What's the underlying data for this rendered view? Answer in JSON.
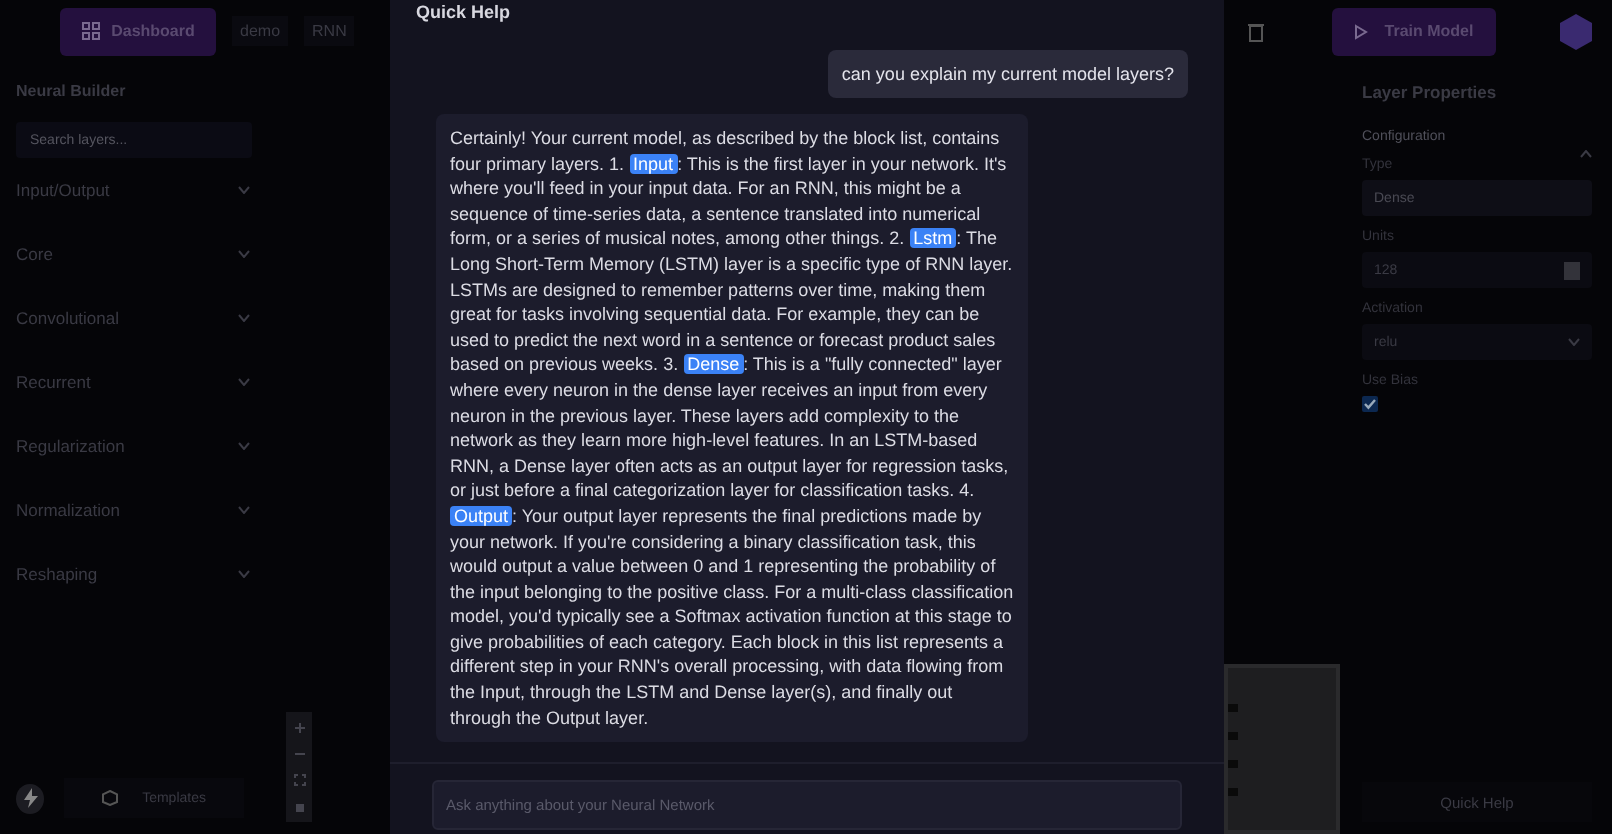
{
  "topbar": {
    "dashboard_button": "Dashboard",
    "breadcrumbs": [
      "demo",
      "RNN"
    ],
    "train_button": "Train Model"
  },
  "sidebar": {
    "title": "Neural Builder",
    "search": {
      "placeholder": "Search layers..."
    },
    "categories": [
      {
        "label": "Input/Output",
        "expanded": false
      },
      {
        "label": "Core",
        "expanded": false
      },
      {
        "label": "Convolutional",
        "expanded": false
      },
      {
        "label": "Recurrent",
        "expanded": false
      },
      {
        "label": "Regularization",
        "expanded": false
      },
      {
        "label": "Normalization",
        "expanded": false
      },
      {
        "label": "Reshaping",
        "expanded": false
      }
    ],
    "templates_button": "Templates"
  },
  "properties": {
    "title": "Layer Properties",
    "section": {
      "label": "Configuration",
      "expanded": true
    },
    "fields": [
      {
        "kind": "text",
        "label": "Type",
        "value": "Dense",
        "disabled": true
      },
      {
        "kind": "number",
        "label": "Units",
        "value": "128"
      },
      {
        "kind": "select",
        "label": "Activation",
        "value": "relu"
      },
      {
        "kind": "checkbox",
        "label": "Use Bias",
        "checked": true
      }
    ],
    "quick_help_button": "Quick Help"
  },
  "chat": {
    "title": "Quick Help",
    "messages": [
      {
        "kind": "user",
        "text": "can you explain my current model layers?"
      },
      {
        "kind": "assistant",
        "parts": [
          {
            "kind": "text",
            "text": "Certainly! Your current model, as described by the block list, contains four primary layers. 1. "
          },
          {
            "kind": "chip",
            "text": "Input"
          },
          {
            "kind": "text",
            "text": ": This is the first layer in your network. It's where you'll feed in your input data. For an RNN, this might be a sequence of time-series data, a sentence translated into numerical form, or a series of musical notes, among other things. 2. "
          },
          {
            "kind": "chip",
            "text": "Lstm"
          },
          {
            "kind": "text",
            "text": ": The Long Short-Term Memory (LSTM) layer is a specific type of RNN layer. LSTMs are designed to remember patterns over time, making them great for tasks involving sequential data. For example, they can be used to predict the next word in a sentence or forecast product sales based on previous weeks. 3. "
          },
          {
            "kind": "chip",
            "text": "Dense"
          },
          {
            "kind": "text",
            "text": ": This is a \"fully connected\" layer where every neuron in the dense layer receives an input from every neuron in the previous layer. These layers add complexity to the network as they learn more high-level features. In an LSTM-based RNN, a Dense layer often acts as an output layer for regression tasks, or just before a final categorization layer for classification tasks. 4. "
          },
          {
            "kind": "chip",
            "text": "Output"
          },
          {
            "kind": "text",
            "text": ": Your output layer represents the final predictions made by your network. If you're considering a binary classification task, this would output a value between 0 and 1 representing the probability of the input belonging to the positive class. For a multi-class classification model, you'd typically see a Softmax activation function at this stage to give probabilities of each category. Each block in this list represents a different step in your RNN's overall processing, with data flowing from the Input, through the LSTM and Dense layer(s), and finally out through the Output layer."
          }
        ]
      }
    ],
    "input": {
      "placeholder": "Ask anything about your Neural Network"
    }
  }
}
